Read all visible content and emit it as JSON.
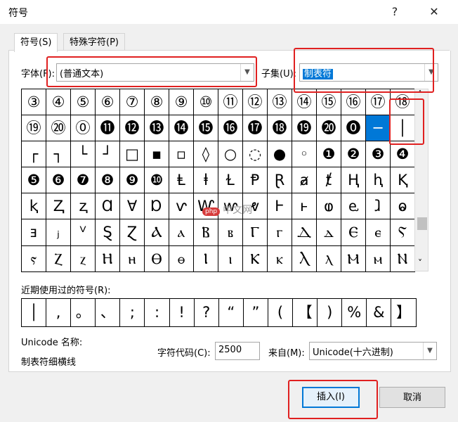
{
  "window": {
    "title": "符号",
    "help": "?",
    "close": "✕"
  },
  "tabs": [
    {
      "label": "符号(S)",
      "active": true
    },
    {
      "label": "特殊字符(P)",
      "active": false
    }
  ],
  "font": {
    "label": "字体(F):",
    "value": "(普通文本)"
  },
  "subset": {
    "label": "子集(U):",
    "value": "制表符"
  },
  "grid": {
    "rows": [
      [
        "③",
        "④",
        "⑤",
        "⑥",
        "⑦",
        "⑧",
        "⑨",
        "⑩",
        "⑪",
        "⑫",
        "⑬",
        "⑭",
        "⑮",
        "⑯",
        "⑰",
        "⑱"
      ],
      [
        "⑲",
        "⑳",
        "⓪",
        "⓫",
        "⓬",
        "⓭",
        "⓮",
        "⓯",
        "⓰",
        "⓱",
        "⓲",
        "⓳",
        "⓴",
        "⓿",
        "─",
        "│"
      ],
      [
        "┌",
        "┐",
        "└",
        "┘",
        "□",
        "▪",
        "▫",
        "◊",
        "○",
        "◌",
        "●",
        "◦",
        "❶",
        "❷",
        "❸",
        "❹"
      ],
      [
        "❺",
        "❻",
        "❼",
        "❽",
        "❾",
        "❿",
        "Ⱡ",
        "ⱡ",
        "Ɫ",
        "Ᵽ",
        "Ɽ",
        "ⱥ",
        "ⱦ",
        "Ⱨ",
        "ⱨ",
        "Ⱪ"
      ],
      [
        "ⱪ",
        "Ⱬ",
        "ⱬ",
        "Ɑ",
        "Ɐ",
        "Ɒ",
        "ⱱ",
        "Ⱳ",
        "ⱳ",
        "ⱴ",
        "Ⱶ",
        "ⱶ",
        "ⱷ",
        "ⱸ",
        "ⱹ",
        "ⱺ"
      ],
      [
        "ⱻ",
        "ⱼ",
        "ⱽ",
        "Ȿ",
        "Ɀ",
        "Ⲁ",
        "ⲁ",
        "Ⲃ",
        "ⲃ",
        "Ⲅ",
        "ⲅ",
        "Ⲇ",
        "ⲇ",
        "Ⲉ",
        "ⲉ",
        "Ⲋ"
      ],
      [
        "ⲋ",
        "Ⲍ",
        "ⲍ",
        "Ⲏ",
        "ⲏ",
        "Ⲑ",
        "ⲑ",
        "Ⲓ",
        "ⲓ",
        "Ⲕ",
        "ⲕ",
        "Ⲗ",
        "ⲗ",
        "Ⲙ",
        "ⲙ",
        "Ⲛ"
      ]
    ],
    "selected": {
      "row": 1,
      "col": 14
    }
  },
  "scroll": {
    "up": "˄",
    "down": "˅"
  },
  "recent": {
    "label": "近期使用过的符号(R):",
    "symbols": [
      "│",
      ",",
      "。",
      "、",
      ";",
      ":",
      "!",
      "?",
      "“",
      "”",
      "(",
      "【",
      ")",
      "%",
      "&",
      "】"
    ]
  },
  "unicode": {
    "label": "Unicode 名称:",
    "name": "制表符细横线"
  },
  "charcode": {
    "label": "字符代码(C):",
    "value": "2500"
  },
  "from": {
    "label": "来自(M):",
    "value": "Unicode(十六进制)"
  },
  "buttons": {
    "insert": "插入(I)",
    "cancel": "取消"
  },
  "watermark": {
    "badge": "php",
    "text": "中文网"
  },
  "accent_colors": {
    "selection": "#0078d7",
    "highlight": "#e02020"
  }
}
